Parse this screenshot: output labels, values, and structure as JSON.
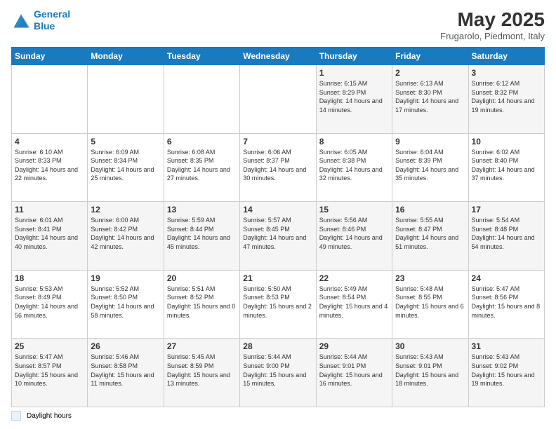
{
  "header": {
    "logo_line1": "General",
    "logo_line2": "Blue",
    "title": "May 2025",
    "subtitle": "Frugarolo, Piedmont, Italy"
  },
  "calendar": {
    "days_of_week": [
      "Sunday",
      "Monday",
      "Tuesday",
      "Wednesday",
      "Thursday",
      "Friday",
      "Saturday"
    ],
    "weeks": [
      [
        {
          "day": "",
          "info": ""
        },
        {
          "day": "",
          "info": ""
        },
        {
          "day": "",
          "info": ""
        },
        {
          "day": "",
          "info": ""
        },
        {
          "day": "1",
          "info": "Sunrise: 6:15 AM\nSunset: 8:29 PM\nDaylight: 14 hours and 14 minutes."
        },
        {
          "day": "2",
          "info": "Sunrise: 6:13 AM\nSunset: 8:30 PM\nDaylight: 14 hours and 17 minutes."
        },
        {
          "day": "3",
          "info": "Sunrise: 6:12 AM\nSunset: 8:32 PM\nDaylight: 14 hours and 19 minutes."
        }
      ],
      [
        {
          "day": "4",
          "info": "Sunrise: 6:10 AM\nSunset: 8:33 PM\nDaylight: 14 hours and 22 minutes."
        },
        {
          "day": "5",
          "info": "Sunrise: 6:09 AM\nSunset: 8:34 PM\nDaylight: 14 hours and 25 minutes."
        },
        {
          "day": "6",
          "info": "Sunrise: 6:08 AM\nSunset: 8:35 PM\nDaylight: 14 hours and 27 minutes."
        },
        {
          "day": "7",
          "info": "Sunrise: 6:06 AM\nSunset: 8:37 PM\nDaylight: 14 hours and 30 minutes."
        },
        {
          "day": "8",
          "info": "Sunrise: 6:05 AM\nSunset: 8:38 PM\nDaylight: 14 hours and 32 minutes."
        },
        {
          "day": "9",
          "info": "Sunrise: 6:04 AM\nSunset: 8:39 PM\nDaylight: 14 hours and 35 minutes."
        },
        {
          "day": "10",
          "info": "Sunrise: 6:02 AM\nSunset: 8:40 PM\nDaylight: 14 hours and 37 minutes."
        }
      ],
      [
        {
          "day": "11",
          "info": "Sunrise: 6:01 AM\nSunset: 8:41 PM\nDaylight: 14 hours and 40 minutes."
        },
        {
          "day": "12",
          "info": "Sunrise: 6:00 AM\nSunset: 8:42 PM\nDaylight: 14 hours and 42 minutes."
        },
        {
          "day": "13",
          "info": "Sunrise: 5:59 AM\nSunset: 8:44 PM\nDaylight: 14 hours and 45 minutes."
        },
        {
          "day": "14",
          "info": "Sunrise: 5:57 AM\nSunset: 8:45 PM\nDaylight: 14 hours and 47 minutes."
        },
        {
          "day": "15",
          "info": "Sunrise: 5:56 AM\nSunset: 8:46 PM\nDaylight: 14 hours and 49 minutes."
        },
        {
          "day": "16",
          "info": "Sunrise: 5:55 AM\nSunset: 8:47 PM\nDaylight: 14 hours and 51 minutes."
        },
        {
          "day": "17",
          "info": "Sunrise: 5:54 AM\nSunset: 8:48 PM\nDaylight: 14 hours and 54 minutes."
        }
      ],
      [
        {
          "day": "18",
          "info": "Sunrise: 5:53 AM\nSunset: 8:49 PM\nDaylight: 14 hours and 56 minutes."
        },
        {
          "day": "19",
          "info": "Sunrise: 5:52 AM\nSunset: 8:50 PM\nDaylight: 14 hours and 58 minutes."
        },
        {
          "day": "20",
          "info": "Sunrise: 5:51 AM\nSunset: 8:52 PM\nDaylight: 15 hours and 0 minutes."
        },
        {
          "day": "21",
          "info": "Sunrise: 5:50 AM\nSunset: 8:53 PM\nDaylight: 15 hours and 2 minutes."
        },
        {
          "day": "22",
          "info": "Sunrise: 5:49 AM\nSunset: 8:54 PM\nDaylight: 15 hours and 4 minutes."
        },
        {
          "day": "23",
          "info": "Sunrise: 5:48 AM\nSunset: 8:55 PM\nDaylight: 15 hours and 6 minutes."
        },
        {
          "day": "24",
          "info": "Sunrise: 5:47 AM\nSunset: 8:56 PM\nDaylight: 15 hours and 8 minutes."
        }
      ],
      [
        {
          "day": "25",
          "info": "Sunrise: 5:47 AM\nSunset: 8:57 PM\nDaylight: 15 hours and 10 minutes."
        },
        {
          "day": "26",
          "info": "Sunrise: 5:46 AM\nSunset: 8:58 PM\nDaylight: 15 hours and 11 minutes."
        },
        {
          "day": "27",
          "info": "Sunrise: 5:45 AM\nSunset: 8:59 PM\nDaylight: 15 hours and 13 minutes."
        },
        {
          "day": "28",
          "info": "Sunrise: 5:44 AM\nSunset: 9:00 PM\nDaylight: 15 hours and 15 minutes."
        },
        {
          "day": "29",
          "info": "Sunrise: 5:44 AM\nSunset: 9:01 PM\nDaylight: 15 hours and 16 minutes."
        },
        {
          "day": "30",
          "info": "Sunrise: 5:43 AM\nSunset: 9:01 PM\nDaylight: 15 hours and 18 minutes."
        },
        {
          "day": "31",
          "info": "Sunrise: 5:43 AM\nSunset: 9:02 PM\nDaylight: 15 hours and 19 minutes."
        }
      ]
    ]
  },
  "footer": {
    "legend_label": "Daylight hours"
  }
}
